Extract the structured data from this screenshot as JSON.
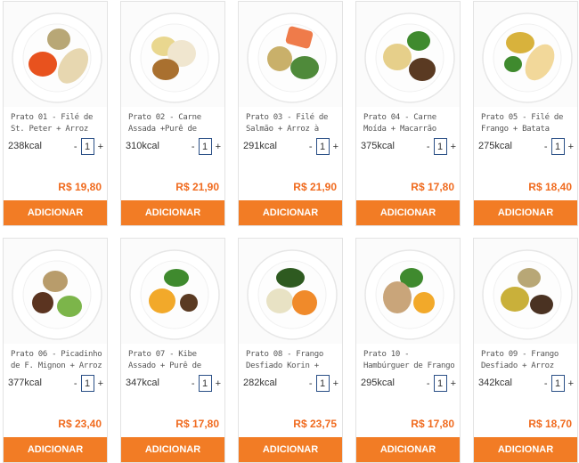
{
  "products": [
    {
      "name": "Prato 01 - Filé de St. Peter + Arroz Integral",
      "kcal": "238kcal",
      "quantity": "1",
      "price": "R$ 19,80",
      "button": "ADICIONAR",
      "photo": "plate-fish-carrot-rice-photo"
    },
    {
      "name": "Prato 02 - Carne Assada +Purê de Batata",
      "kcal": "310kcal",
      "quantity": "1",
      "price": "R$ 21,90",
      "button": "ADICIONAR",
      "photo": "plate-roast-beef-mash-photo"
    },
    {
      "name": "Prato 03 - Filé de Salmão + Arroz à Grega",
      "kcal": "291kcal",
      "quantity": "1",
      "price": "R$ 21,90",
      "button": "ADICIONAR",
      "photo": "plate-salmon-rice-beans-photo"
    },
    {
      "name": "Prato 04 - Carne Moída + Macarrão Integral + ",
      "kcal": "375kcal",
      "quantity": "1",
      "price": "R$ 17,80",
      "button": "ADICIONAR",
      "photo": "plate-ground-beef-pasta-photo"
    },
    {
      "name": "Prato 05 - Filé de Frango + Batata Sauteé",
      "kcal": "275kcal",
      "quantity": "1",
      "price": "R$ 18,40",
      "button": "ADICIONAR",
      "photo": "plate-chicken-potato-photo"
    },
    {
      "name": "Prato 06 - Picadinho de F. Mignon + Arroz",
      "kcal": "377kcal",
      "quantity": "1",
      "price": "R$ 23,40",
      "button": "ADICIONAR",
      "photo": "plate-mignon-rice-beans-photo"
    },
    {
      "name": "Prato 07 - Kibe Assado + Purê de",
      "kcal": "347kcal",
      "quantity": "1",
      "price": "R$ 17,80",
      "button": "ADICIONAR",
      "photo": "plate-kibe-mash-photo"
    },
    {
      "name": "Prato 08 - Frango Desfiado Korin + Purê",
      "kcal": "282kcal",
      "quantity": "1",
      "price": "R$ 23,75",
      "button": "ADICIONAR",
      "photo": "plate-shredded-chicken-photo"
    },
    {
      "name": "Prato 10 - Hambúrguer de Frango + Purê de",
      "kcal": "295kcal",
      "quantity": "1",
      "price": "R$ 17,80",
      "button": "ADICIONAR",
      "photo": "plate-chicken-burger-photo"
    },
    {
      "name": "Prato 09 - Frango Desfiado + Arroz",
      "kcal": "342kcal",
      "quantity": "1",
      "price": "R$ 18,70",
      "button": "ADICIONAR",
      "photo": "plate-shredded-chicken-rice-photo"
    }
  ],
  "controls": {
    "minus": "-",
    "plus": "+"
  },
  "colors": {
    "accent": "#f27c25",
    "price": "#f06b1f",
    "qty_border": "#2a4f86"
  }
}
